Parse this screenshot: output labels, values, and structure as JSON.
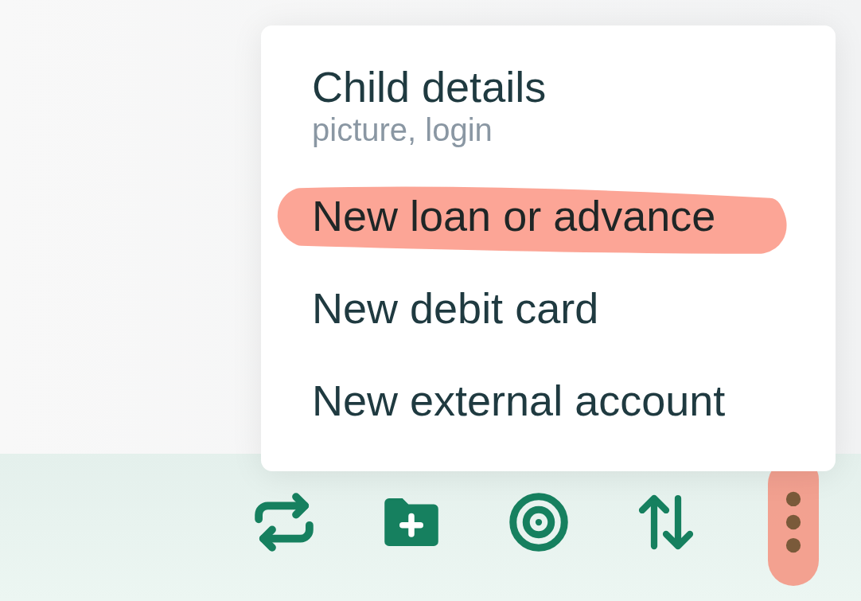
{
  "menu": {
    "items": [
      {
        "label": "Child details",
        "subtitle": "picture, login",
        "highlighted": false
      },
      {
        "label": "New loan or advance",
        "highlighted": true
      },
      {
        "label": "New debit card",
        "highlighted": false
      },
      {
        "label": "New external account",
        "highlighted": false
      }
    ]
  },
  "toolbar": [
    {
      "kind": "repeat",
      "highlighted": false
    },
    {
      "kind": "folder-add",
      "highlighted": false
    },
    {
      "kind": "target",
      "highlighted": false
    },
    {
      "kind": "sort",
      "highlighted": false
    },
    {
      "kind": "more",
      "highlighted": true
    }
  ]
}
